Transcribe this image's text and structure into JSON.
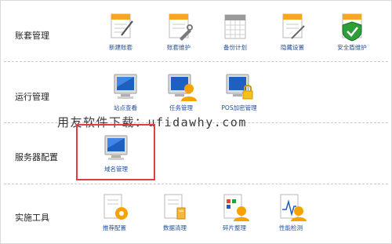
{
  "sections": [
    {
      "label": "账套管理",
      "items": [
        {
          "label": "新建账套",
          "icon": "new-account-icon"
        },
        {
          "label": "账套维护",
          "icon": "account-maintain-icon"
        },
        {
          "label": "备份计划",
          "icon": "backup-plan-icon"
        },
        {
          "label": "隐藏设置",
          "icon": "hidden-settings-icon"
        },
        {
          "label": "安全盾维护",
          "icon": "security-shield-icon"
        }
      ]
    },
    {
      "label": "运行管理",
      "items": [
        {
          "label": "站点查看",
          "icon": "monitor-icon"
        },
        {
          "label": "任务管理",
          "icon": "monitor-user-icon"
        },
        {
          "label": "POS加密管理",
          "icon": "monitor-lock-icon"
        }
      ]
    },
    {
      "label": "服务器配置",
      "items": [
        {
          "label": "域名管理",
          "icon": "monitor-icon"
        }
      ]
    },
    {
      "label": "实施工具",
      "items": [
        {
          "label": "推荐配置",
          "icon": "gear-document-icon"
        },
        {
          "label": "数据清理",
          "icon": "data-cleanup-icon"
        },
        {
          "label": "碎片整理",
          "icon": "defrag-icon"
        },
        {
          "label": "性能检测",
          "icon": "performance-check-icon"
        }
      ]
    }
  ],
  "watermark": "用友软件下载：ufidawhy.com",
  "colors": {
    "link": "#1f4e9a",
    "highlight": "#e33c3c",
    "separator": "#c8c8c8"
  }
}
